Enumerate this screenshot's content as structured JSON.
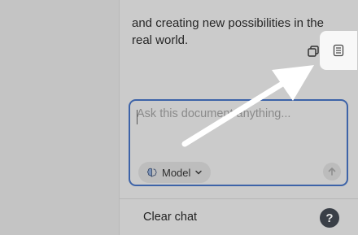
{
  "message": {
    "line1": "and creating new possibilities in the",
    "line2": "real world."
  },
  "actions": {
    "copy_icon": "copy-icon",
    "document_icon": "document-list-icon"
  },
  "composer": {
    "placeholder": "Ask this document anything...",
    "value": "",
    "model_label": "Model",
    "model_icon": "brain-icon",
    "send_icon": "arrow-up-icon"
  },
  "footer": {
    "clear_chat_label": "Clear chat",
    "help_label": "?"
  },
  "colors": {
    "focus_border": "#3d63a8",
    "overlay": "#c4c4c4",
    "highlight": "#f8f8f8",
    "annotation_arrow": "#ffffff"
  }
}
